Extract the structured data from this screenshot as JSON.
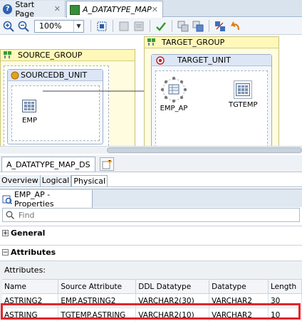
{
  "tabs": [
    {
      "label": "Start Page",
      "icon": "help-icon"
    },
    {
      "label": "A_DATATYPE_MAP",
      "icon": "mapping-icon"
    }
  ],
  "toolbar": {
    "zoom": "100%"
  },
  "canvas": {
    "source_group": {
      "title": "SOURCE_GROUP",
      "unit": {
        "title": "SOURCEDB_UNIT",
        "node": "EMP"
      }
    },
    "target_group": {
      "title": "TARGET_GROUP",
      "unit": {
        "title": "TARGET_UNIT",
        "nodes": [
          "EMP_AP",
          "TGTEMP"
        ]
      }
    }
  },
  "model_tab": "A_DATATYPE_MAP_DS",
  "view_tabs": [
    "Overview",
    "Logical",
    "Physical"
  ],
  "properties": {
    "title": "EMP_AP - Properties",
    "find_placeholder": "Find",
    "sections": {
      "general": "General",
      "attributes": "Attributes"
    },
    "attributes_label": "Attributes:",
    "columns": [
      "Name",
      "Source Attribute",
      "DDL Datatype",
      "Datatype",
      "Length"
    ],
    "rows": [
      [
        "ASTRING2",
        "EMP.ASTRING2",
        "VARCHAR2(30)",
        "VARCHAR2",
        "30"
      ],
      [
        "ASTRING",
        "TGTEMP.ASTRING",
        "VARCHAR2(10)",
        "VARCHAR2",
        "10"
      ]
    ]
  },
  "colors": {
    "highlight": "#e0262c",
    "group_fill": "#fffce0",
    "unit_title": "#dce6f6"
  }
}
